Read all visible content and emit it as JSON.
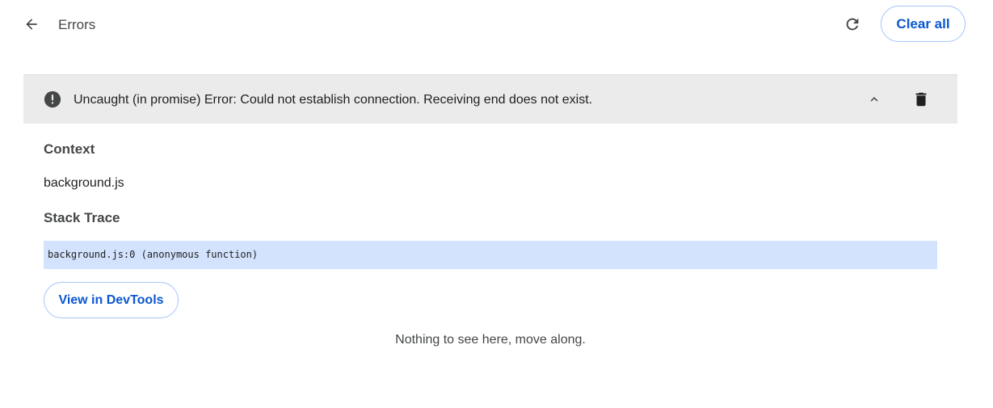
{
  "header": {
    "back_icon": "arrow-back-icon",
    "title": "Errors",
    "reload_icon": "reload-icon",
    "clear_all_label": "Clear all"
  },
  "error": {
    "icon": "error-exclamation-icon",
    "message": "Uncaught (in promise) Error: Could not establish connection. Receiving end does not exist.",
    "collapse_icon": "chevron-up-icon",
    "delete_icon": "trash-icon",
    "context_heading": "Context",
    "context_value": "background.js",
    "stack_heading": "Stack Trace",
    "stack_frames": [
      "background.js:0 (anonymous function)"
    ],
    "devtools_label": "View in DevTools"
  },
  "empty_message": "Nothing to see here, move along.",
  "colors": {
    "accent": "#0b57d0",
    "button_border": "#a8c7fa",
    "error_header_bg": "#ebebeb",
    "stack_highlight": "#d3e3fd"
  }
}
